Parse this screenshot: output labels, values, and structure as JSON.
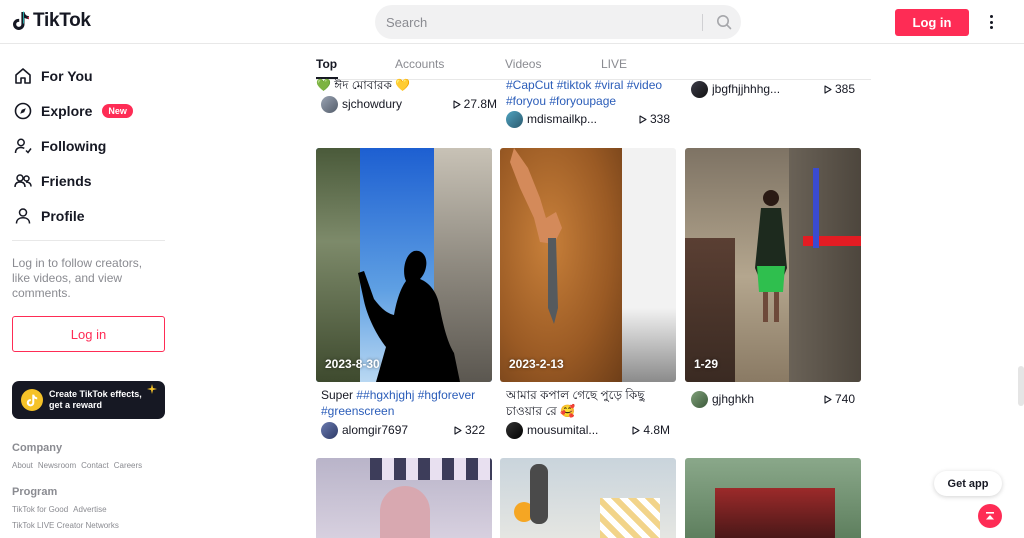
{
  "header": {
    "logo_text": "TikTok",
    "search_placeholder": "Search",
    "login_label": "Log in"
  },
  "sidebar": {
    "nav": [
      {
        "label": "For You",
        "icon": "home-icon"
      },
      {
        "label": "Explore",
        "icon": "compass-icon",
        "badge": "New"
      },
      {
        "label": "Following",
        "icon": "following-icon"
      },
      {
        "label": "Friends",
        "icon": "friends-icon"
      },
      {
        "label": "Profile",
        "icon": "profile-icon"
      }
    ],
    "login_hint": "Log in to follow creators, like videos, and view comments.",
    "login_label": "Log in",
    "effects_line1": "Create TikTok effects,",
    "effects_line2": "get a reward",
    "footer": {
      "company_head": "Company",
      "company_links": [
        "About",
        "Newsroom",
        "Contact",
        "Careers"
      ],
      "program_head": "Program",
      "program_links_1": [
        "TikTok for Good",
        "Advertise"
      ],
      "program_links_2": [
        "TikTok LIVE Creator Networks"
      ]
    }
  },
  "tabs": [
    "Top",
    "Accounts",
    "Videos",
    "LIVE"
  ],
  "row1": [
    {
      "caption": "💚 ঈদ মোবারক 💛",
      "author": "sjchowdury",
      "views": "27.8M"
    },
    {
      "caption_tags": "#CapCut #tiktok #viral #video #foryou #foryoupage",
      "author": "mdismailkp...",
      "views": "338"
    },
    {
      "author": "jbgfhjjhhhg...",
      "views": "385"
    }
  ],
  "row2": [
    {
      "date": "2023-8-30",
      "caption_prefix": "Super ",
      "caption_tags": "##hgxhjghj #hgforever #greenscreen",
      "author": "alomgir7697",
      "views": "322"
    },
    {
      "date": "2023-2-13",
      "caption": "আমার কপাল গেছে পুড়ে কিছু চাওয়ার রে 🥰",
      "author": "mousumital...",
      "views": "4.8M"
    },
    {
      "date": "1-29",
      "author": "gjhghkh",
      "views": "740"
    }
  ],
  "floating": {
    "get_app_label": "Get app"
  },
  "colors": {
    "brand": "#fe2c55",
    "hashtag": "#2b5db9",
    "muted": "#8a8b91"
  }
}
